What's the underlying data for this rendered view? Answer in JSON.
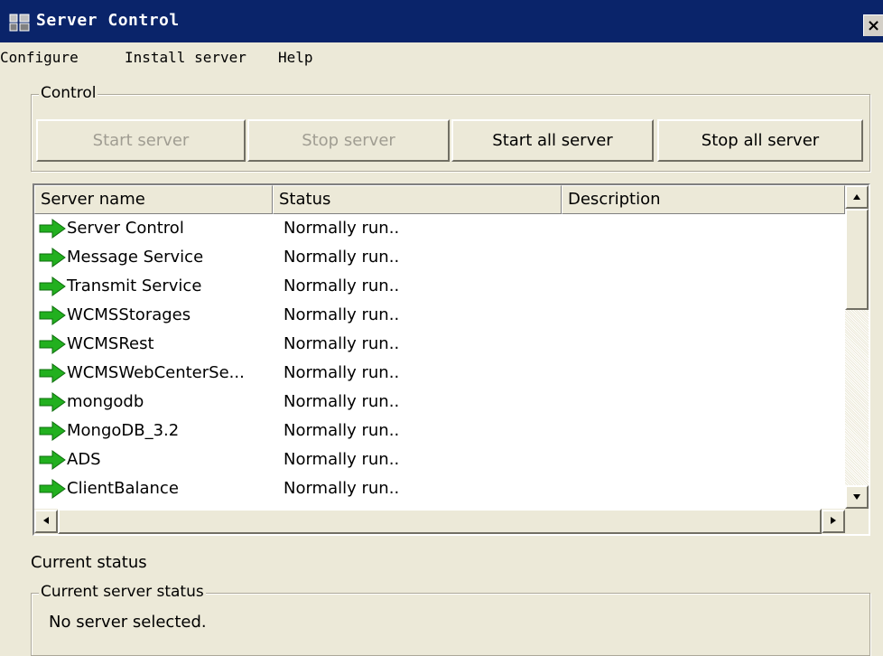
{
  "window": {
    "title": "Server Control",
    "close_glyph": "×"
  },
  "menu": {
    "items": [
      "Configure",
      "Install server",
      "Help"
    ]
  },
  "control": {
    "legend": "Control",
    "buttons": [
      {
        "label": "Start server",
        "enabled": false
      },
      {
        "label": "Stop server",
        "enabled": false
      },
      {
        "label": "Start all server",
        "enabled": true
      },
      {
        "label": "Stop all server",
        "enabled": true
      }
    ]
  },
  "server_list": {
    "columns": [
      "Server name",
      "Status",
      "Description"
    ],
    "rows": [
      {
        "name": "Server Control",
        "status": "Normally run..",
        "description": ""
      },
      {
        "name": "Message Service",
        "status": "Normally run..",
        "description": ""
      },
      {
        "name": "Transmit Service",
        "status": "Normally run..",
        "description": ""
      },
      {
        "name": "WCMSStorages",
        "status": "Normally run..",
        "description": ""
      },
      {
        "name": "WCMSRest",
        "status": "Normally run..",
        "description": ""
      },
      {
        "name": "WCMSWebCenterSe...",
        "status": "Normally run..",
        "description": ""
      },
      {
        "name": "mongodb",
        "status": "Normally run..",
        "description": ""
      },
      {
        "name": "MongoDB_3.2",
        "status": "Normally run..",
        "description": ""
      },
      {
        "name": "ADS",
        "status": "Normally run..",
        "description": ""
      },
      {
        "name": "ClientBalance",
        "status": "Normally run..",
        "description": ""
      }
    ],
    "row_icon": "green-arrow-icon"
  },
  "current_status": {
    "label": "Current status",
    "legend": "Current server status",
    "message": "No server selected."
  },
  "colors": {
    "titlebar": "#0a246a",
    "face": "#ece9d8",
    "arrow_green": "#22b01f"
  }
}
